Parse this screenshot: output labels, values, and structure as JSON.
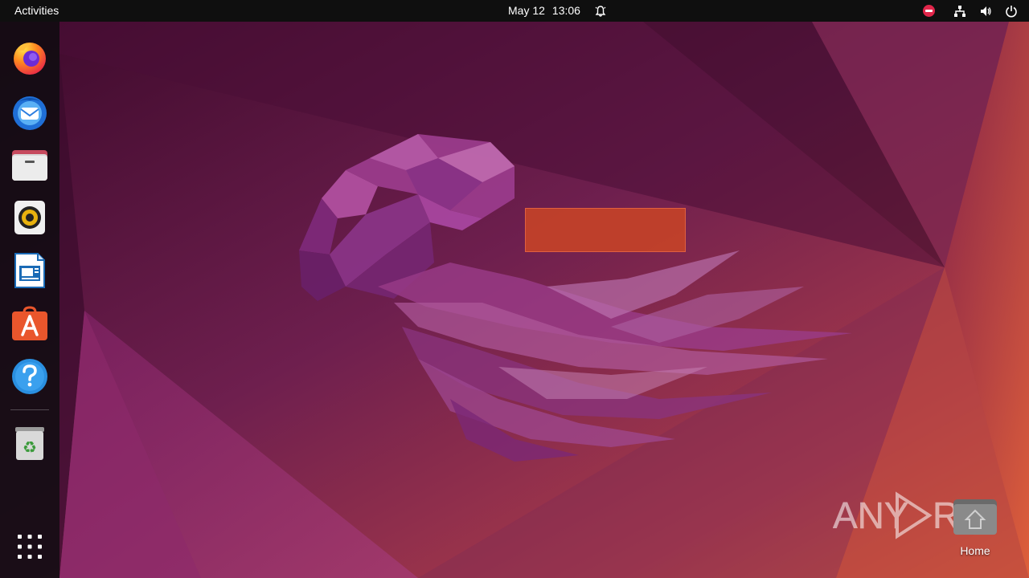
{
  "topbar": {
    "activities": "Activities",
    "date": "May 12",
    "time": "13:06",
    "icons": [
      "bell-icon",
      "do-not-disturb-icon",
      "network-icon",
      "volume-icon",
      "power-icon"
    ]
  },
  "dock": {
    "items": [
      {
        "name": "firefox",
        "icon": "firefox-icon"
      },
      {
        "name": "thunderbird",
        "icon": "thunderbird-icon"
      },
      {
        "name": "files",
        "icon": "files-icon"
      },
      {
        "name": "rhythmbox",
        "icon": "rhythmbox-icon"
      },
      {
        "name": "libreoffice-writer",
        "icon": "writer-icon"
      },
      {
        "name": "ubuntu-software",
        "icon": "software-icon"
      },
      {
        "name": "help",
        "icon": "help-icon"
      },
      {
        "name": "trash",
        "icon": "trash-icon"
      },
      {
        "name": "show-apps",
        "icon": "app-grid-icon"
      }
    ]
  },
  "desktop": {
    "home_label": "Home"
  },
  "watermark": {
    "text_left": "ANY",
    "text_right": "RUN"
  },
  "colors": {
    "topbar": "#0f0f0f",
    "dock": "#120c12",
    "highlight": "#c44228",
    "dnd": "#e0264a"
  }
}
